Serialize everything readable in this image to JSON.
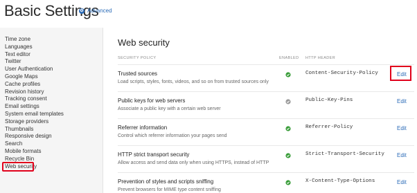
{
  "header": {
    "title": "Basic Settings",
    "advanced_label": "Advanced"
  },
  "sidebar": {
    "items": [
      {
        "label": "Time zone"
      },
      {
        "label": "Languages"
      },
      {
        "label": "Text editor"
      },
      {
        "label": "Twitter"
      },
      {
        "label": "User Authentication"
      },
      {
        "label": "Google Maps"
      },
      {
        "label": "Cache profiles"
      },
      {
        "label": "Revision history"
      },
      {
        "label": "Tracking consent"
      },
      {
        "label": "Email settings"
      },
      {
        "label": "System email templates"
      },
      {
        "label": "Storage providers"
      },
      {
        "label": "Thumbnails"
      },
      {
        "label": "Responsive design"
      },
      {
        "label": "Search"
      },
      {
        "label": "Mobile formats"
      },
      {
        "label": "Recycle Bin"
      },
      {
        "label": "Web security",
        "active": true
      }
    ]
  },
  "main": {
    "title": "Web security",
    "columns": {
      "policy": "SECURITY POLICY",
      "enabled": "ENABLED",
      "header": "HTTP HEADER"
    },
    "rows": [
      {
        "name": "Trusted sources",
        "description": "Load scripts, styles, fonts, videos, and so on from trusted sources only",
        "enabled": true,
        "header": "Content-Security-Policy",
        "edit": "Edit",
        "highlighted": true
      },
      {
        "name": "Public keys for web servers",
        "description": "Associate a public key with a certain web server",
        "enabled": false,
        "header": "Public-Key-Pins",
        "edit": "Edit"
      },
      {
        "name": "Referrer information",
        "description": "Control which referrer information your pages send",
        "enabled": true,
        "header": "Referrer-Policy",
        "edit": "Edit"
      },
      {
        "name": "HTTP strict transport security",
        "description": "Allow access and send data only when using HTTPS, instead of HTTP",
        "enabled": true,
        "header": "Strict-Transport-Security",
        "edit": "Edit"
      },
      {
        "name": "Prevention of styles and scripts sniffing",
        "description": "Prevent browsers for MIME type content sniffing",
        "enabled": true,
        "header": "X-Content-Type-Options",
        "edit": "Edit"
      }
    ]
  },
  "colors": {
    "enabled_check": "#3a9d3a",
    "disabled_check": "#9a9a9a",
    "highlight_box": "#e0001b",
    "link": "#2a6bb7"
  },
  "icons": {
    "advanced": "gear-circle-icon",
    "enabled": "check-circle-icon"
  }
}
